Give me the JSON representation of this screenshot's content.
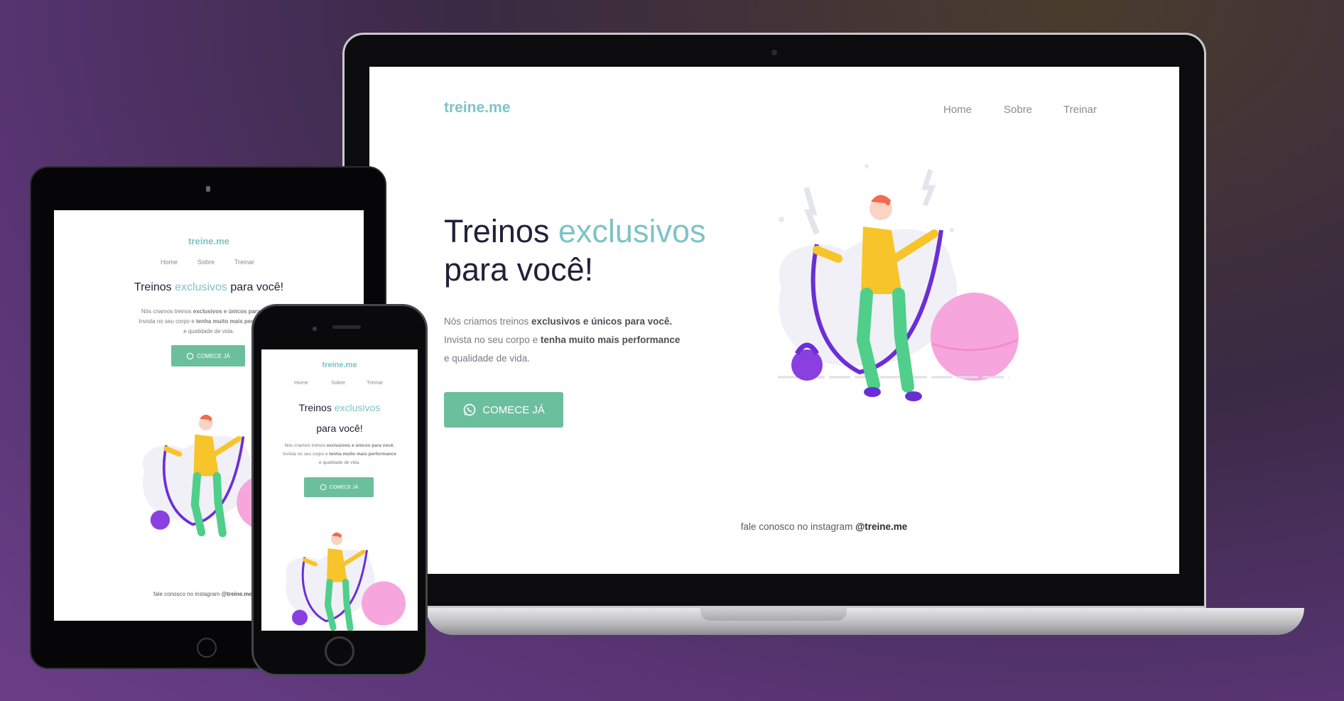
{
  "site": {
    "logo": "treine.me",
    "nav": [
      "Home",
      "Sobre",
      "Treinar"
    ],
    "title_pre": "Treinos ",
    "title_accent": "exclusivos",
    "title_post": " para você!",
    "text_1": "Nós criamos treinos ",
    "text_1_bold": "exclusivos e únicos para você.",
    "text_2": "Invista no seu corpo e ",
    "text_2_bold": "tenha muito mais performance",
    "text_3": "e qualidade de vida.",
    "cta": "COMECE JÁ",
    "footer_pre": "fale conosco no instagram ",
    "footer_handle": "@treine.me"
  },
  "colors": {
    "accent": "#7ec3c6",
    "button": "#6cbf9c",
    "title": "#23203a",
    "pink": "#f6a6dc",
    "purple": "#6b2ed6",
    "yellow": "#f7c42a",
    "green": "#4fcf8a"
  },
  "icons": {
    "cta_icon": "whatsapp-icon"
  }
}
